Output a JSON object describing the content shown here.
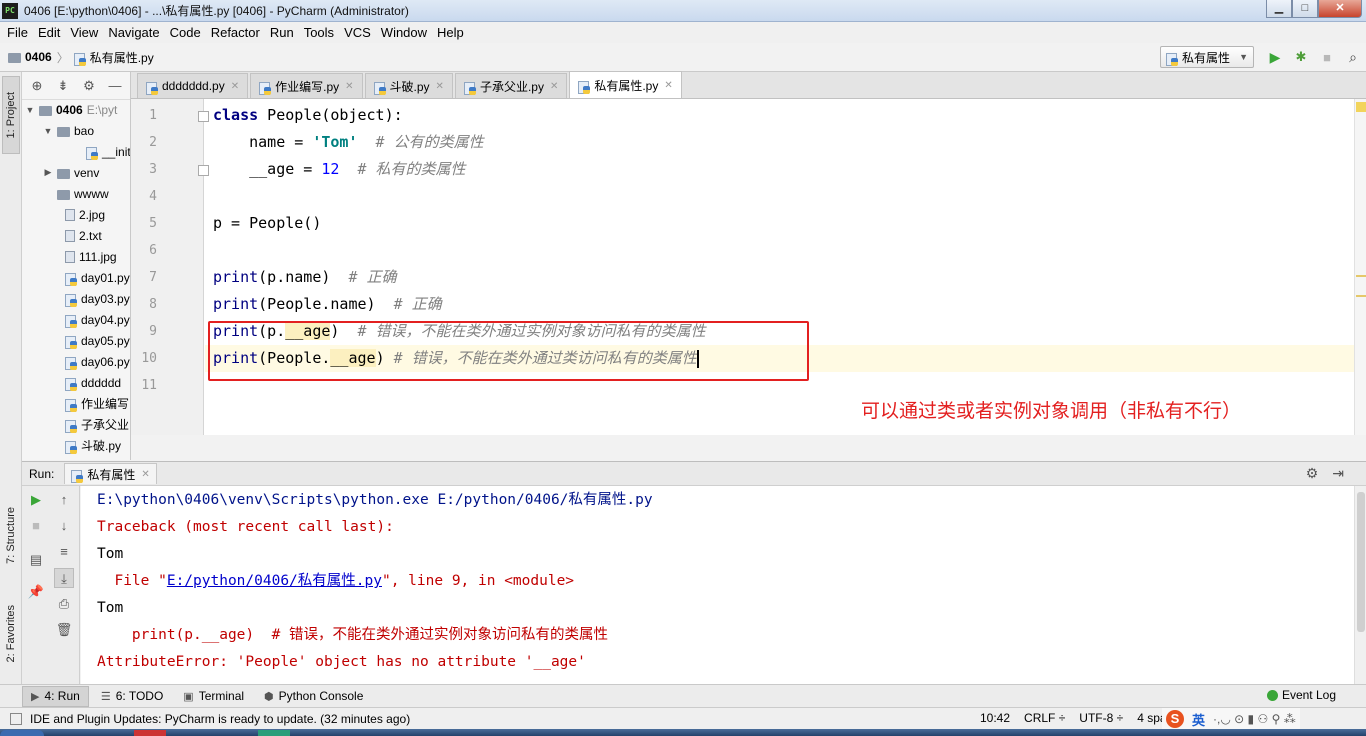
{
  "window": {
    "title": "0406 [E:\\python\\0406] - ...\\私有属性.py [0406] - PyCharm (Administrator)",
    "app_icon": "PC",
    "minimize": "▁",
    "maximize": "□",
    "close": "✕"
  },
  "menu": [
    "File",
    "Edit",
    "View",
    "Navigate",
    "Code",
    "Refactor",
    "Run",
    "Tools",
    "VCS",
    "Window",
    "Help"
  ],
  "breadcrumb": {
    "project": "0406",
    "file": "私有属性.py"
  },
  "run_config": {
    "name": "私有属性"
  },
  "left_tabs": {
    "project": "1: Project",
    "structure": "7: Structure",
    "favorites": "2: Favorites"
  },
  "project_tree": {
    "root": {
      "name": "0406",
      "path": "E:\\pyt"
    },
    "items": [
      {
        "name": "bao",
        "type": "folder",
        "level": 1,
        "expanded": true
      },
      {
        "name": "__init",
        "type": "py",
        "level": 2
      },
      {
        "name": "venv",
        "type": "folder",
        "level": 1,
        "expanded": false
      },
      {
        "name": "wwww",
        "type": "folder",
        "level": 1
      },
      {
        "name": "2.jpg",
        "type": "file",
        "level": 1
      },
      {
        "name": "2.txt",
        "type": "file",
        "level": 1
      },
      {
        "name": "111.jpg",
        "type": "file",
        "level": 1
      },
      {
        "name": "day01.py",
        "type": "py",
        "level": 1
      },
      {
        "name": "day03.py",
        "type": "py",
        "level": 1
      },
      {
        "name": "day04.py",
        "type": "py",
        "level": 1
      },
      {
        "name": "day05.py",
        "type": "py",
        "level": 1
      },
      {
        "name": "day06.py",
        "type": "py",
        "level": 1
      },
      {
        "name": "dddddd",
        "type": "py",
        "level": 1
      },
      {
        "name": "作业编写",
        "type": "py",
        "level": 1
      },
      {
        "name": "子承父业",
        "type": "py",
        "level": 1
      },
      {
        "name": "斗破.py",
        "type": "py",
        "level": 1
      }
    ]
  },
  "editor_tabs": [
    {
      "label": "ddddddd.py",
      "active": false
    },
    {
      "label": "作业编写.py",
      "active": false
    },
    {
      "label": "斗破.py",
      "active": false
    },
    {
      "label": "子承父业.py",
      "active": false
    },
    {
      "label": "私有属性.py",
      "active": true
    }
  ],
  "code": {
    "line_numbers": [
      "1",
      "2",
      "3",
      "4",
      "5",
      "6",
      "7",
      "8",
      "9",
      "10",
      "11"
    ],
    "l1": {
      "kw": "class",
      "rest": " People(object):"
    },
    "l2": {
      "indent": "    name = ",
      "str": "'Tom'",
      "comment": "  # 公有的类属性"
    },
    "l3": {
      "indent": "    __age = ",
      "num": "12",
      "comment": "  # 私有的类属性"
    },
    "l5": "p = People()",
    "l7": {
      "fn": "print",
      "args": "(p.name)",
      "comment": "  # 正确"
    },
    "l8": {
      "fn": "print",
      "args": "(People.name)",
      "comment": "  # 正确"
    },
    "l9": {
      "fn": "print",
      "pre": "(p.",
      "hl": "__age",
      "post": ")",
      "comment": "  # 错误，不能在类外通过实例对象访问私有的类属性"
    },
    "l10": {
      "fn": "print",
      "pre": "(People.",
      "hl": "__age",
      "post": ")",
      "comment": " # 错误，不能在类外通过类访问私有的类属性"
    }
  },
  "annotation": "可以通过类或者实例对象调用（非私有不行）",
  "run_panel": {
    "label": "Run:",
    "tab": "私有属性"
  },
  "console": {
    "l1": "E:\\python\\0406\\venv\\Scripts\\python.exe E:/python/0406/私有属性.py",
    "l2": "Traceback (most recent call last):",
    "l3": "Tom",
    "l4_pre": "  File \"",
    "l4_link": "E:/python/0406/私有属性.py",
    "l4_post": "\", line 9, in <module>",
    "l5": "Tom",
    "l6": "    print(p.__age)  # 错误，不能在类外通过实例对象访问私有的类属性",
    "l7": "AttributeError: 'People' object has no attribute '__age'"
  },
  "bottom_tabs": [
    {
      "label": "4: Run",
      "icon": "▶",
      "active": true
    },
    {
      "label": "6: TODO",
      "icon": "☰",
      "active": false
    },
    {
      "label": "Terminal",
      "icon": "▣",
      "active": false
    },
    {
      "label": "Python Console",
      "icon": "⬢",
      "active": false
    }
  ],
  "event_log": "Event Log",
  "status": {
    "message": "IDE and Plugin Updates: PyCharm is ready to update. (32 minutes ago)",
    "position": "10:42",
    "line_sep": "CRLF ÷",
    "encoding": "UTF-8 ÷",
    "indent": "4 spac"
  },
  "ime": {
    "logo": "S",
    "lang": "英",
    "symbols": "·,◡ ⊙ ▮ ⚇ ⚲ ⁂"
  },
  "colors": {
    "accent_red": "#e32020",
    "run_green": "#3aa638"
  }
}
